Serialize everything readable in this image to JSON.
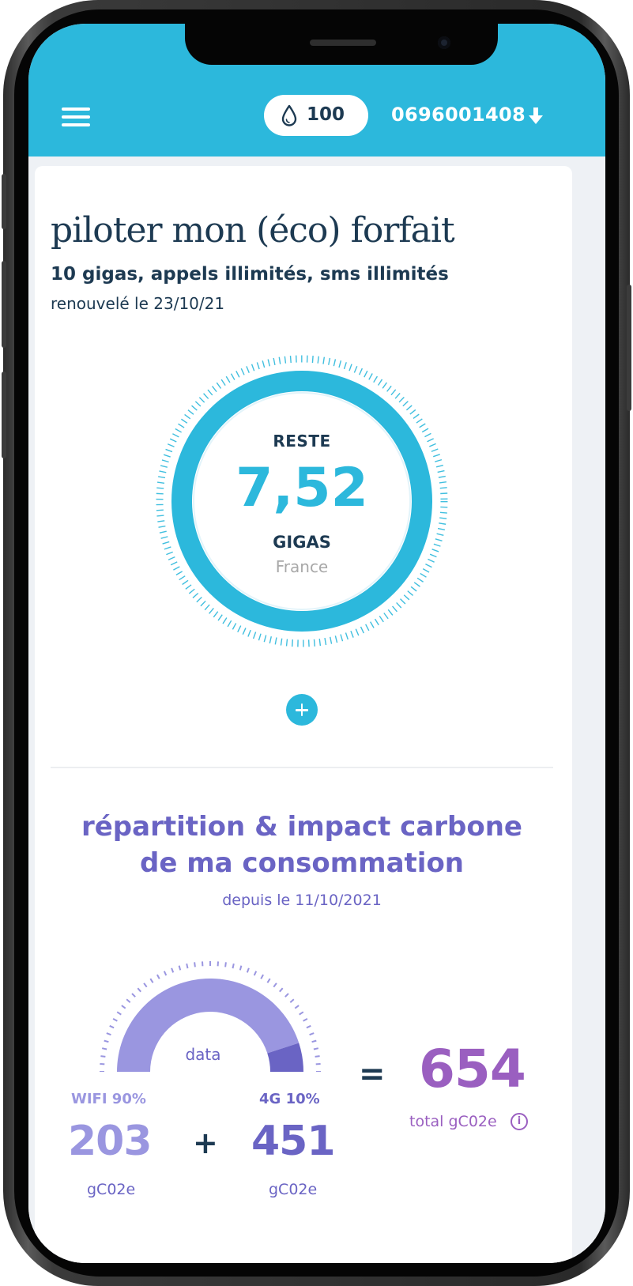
{
  "header": {
    "points": "100",
    "phone_number": "0696001408",
    "accent_color": "#2cb8dc",
    "icons": [
      "menu-icon",
      "drop-icon",
      "download-icon"
    ]
  },
  "plan": {
    "title": "piloter mon (éco) forfait",
    "subtitle": "10 gigas, appels illimités, sms illimités",
    "renewal": "renouvelé le 23/10/21"
  },
  "gauge": {
    "label_top": "RESTE",
    "value": "7,52",
    "unit": "GIGAS",
    "country": "France"
  },
  "carbon": {
    "title_line1": "répartition & impact carbone",
    "title_line2": "de ma consommation",
    "since": "depuis le 11/10/2021",
    "chart_label": "data",
    "wifi_share": 0.9,
    "fourg_share": 0.1,
    "wifi_label": "WIFI 90%",
    "wifi_value": "203",
    "wifi_unit": "gC02e",
    "fourg_label": "4G 10%",
    "fourg_value": "451",
    "fourg_unit": "gC02e",
    "plus": "+",
    "equals": "=",
    "total_value": "654",
    "total_label": "total gC02e",
    "info": "i",
    "colors": {
      "wifi": "#9a96e0",
      "fourg": "#6a64c4",
      "total": "#9a5fc0"
    }
  }
}
